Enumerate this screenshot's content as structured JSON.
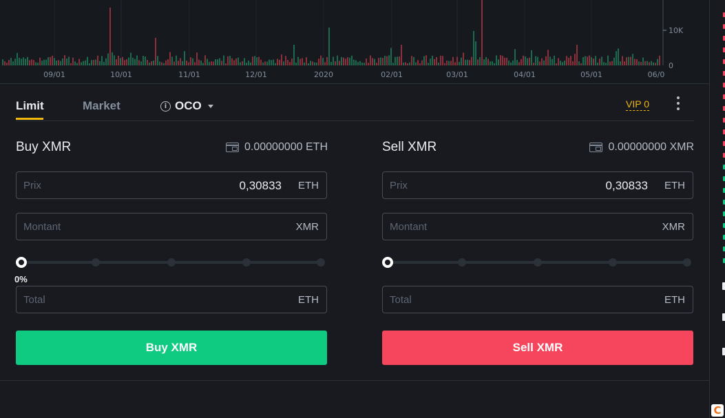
{
  "colors": {
    "buy": "#0ecb81",
    "sell": "#f6465d",
    "accent": "#f0b90b",
    "background": "#181a20"
  },
  "chart": {
    "x_ticks": [
      "09/01",
      "10/01",
      "11/01",
      "12/01",
      "2020",
      "02/01",
      "03/01",
      "04/01",
      "05/01",
      "06/0"
    ],
    "y_ticks": [
      "10K",
      "0"
    ]
  },
  "tabs": {
    "limit": "Limit",
    "market": "Market",
    "oco": "OCO"
  },
  "vip_label": "VIP 0",
  "buy": {
    "title": "Buy XMR",
    "balance": "0.00000000 ETH",
    "price": {
      "placeholder": "Prix",
      "value": "0,30833",
      "unit": "ETH"
    },
    "amount": {
      "placeholder": "Montant",
      "unit": "XMR"
    },
    "slider_value": "0%",
    "slider_percent": 0,
    "total": {
      "placeholder": "Total",
      "unit": "ETH"
    },
    "button": "Buy XMR"
  },
  "sell": {
    "title": "Sell XMR",
    "balance": "0.00000000 XMR",
    "price": {
      "placeholder": "Prix",
      "value": "0,30833",
      "unit": "ETH"
    },
    "amount": {
      "placeholder": "Montant",
      "unit": "XMR"
    },
    "slider_percent": 0,
    "total": {
      "placeholder": "Total",
      "unit": "ETH"
    },
    "button": "Sell XMR"
  },
  "icons": [
    "info-icon",
    "caret-down-icon",
    "more-icon",
    "wallet-icon",
    "brand-logo"
  ]
}
